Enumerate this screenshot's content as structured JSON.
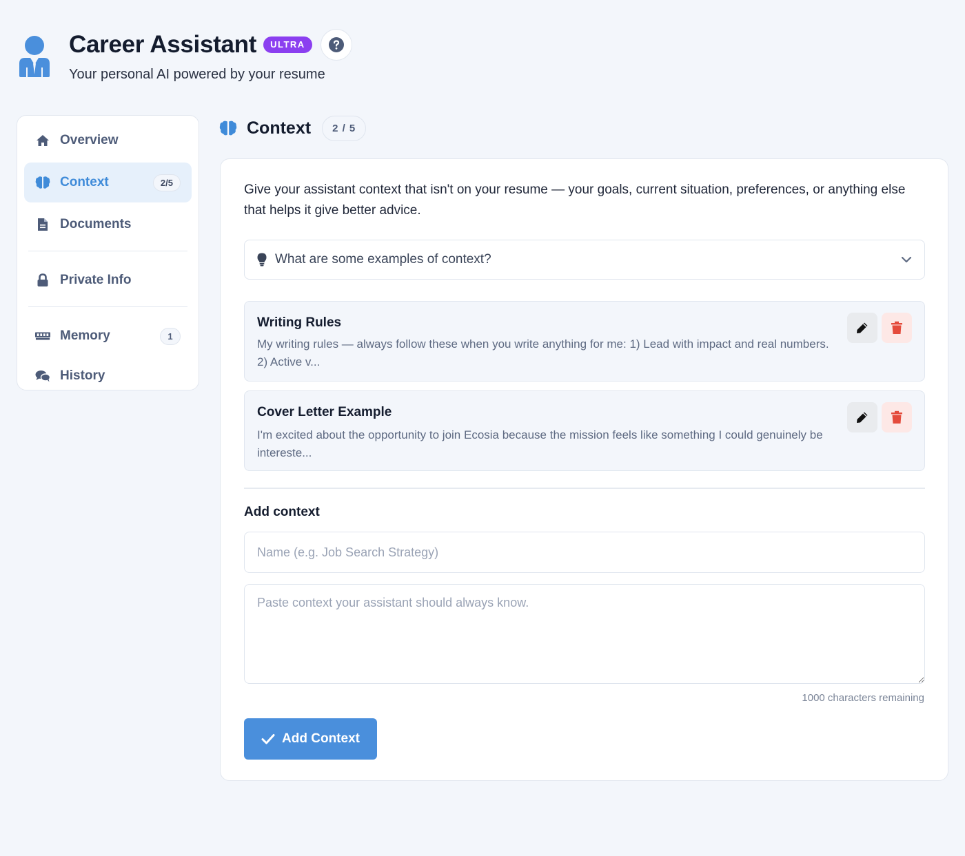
{
  "header": {
    "title": "Career Assistant",
    "badge": "ULTRA",
    "subtitle": "Your personal AI powered by your resume"
  },
  "sidebar": {
    "items": [
      {
        "label": "Overview",
        "icon": "home-icon"
      },
      {
        "label": "Context",
        "icon": "brain-icon",
        "count": "2/5",
        "active": true
      },
      {
        "label": "Documents",
        "icon": "document-icon"
      },
      {
        "label": "Private Info",
        "icon": "lock-icon"
      },
      {
        "label": "Memory",
        "icon": "memory-icon",
        "count": "1"
      },
      {
        "label": "History",
        "icon": "chat-icon"
      }
    ]
  },
  "section": {
    "title": "Context",
    "count": "2 / 5"
  },
  "panel": {
    "intro": "Give your assistant context that isn't on your resume — your goals, current situation, preferences, or anything else that helps it give better advice.",
    "examples_label": "What are some examples of context?",
    "contexts": [
      {
        "title": "Writing Rules",
        "preview": "My writing rules — always follow these when you write anything for me: 1) Lead with impact and real numbers. 2) Active v..."
      },
      {
        "title": "Cover Letter Example",
        "preview": "I'm excited about the opportunity to join Ecosia because the mission feels like something I could genuinely be intereste..."
      }
    ],
    "add_heading": "Add context",
    "name_placeholder": "Name (e.g. Job Search Strategy)",
    "content_placeholder": "Paste context your assistant should always know.",
    "char_remaining": "1000 characters remaining",
    "add_button": "Add Context"
  },
  "colors": {
    "accent": "#4a8fdc",
    "badge": "#8b3ff0",
    "delete": "#e44b3c",
    "background": "#f3f6fb"
  }
}
